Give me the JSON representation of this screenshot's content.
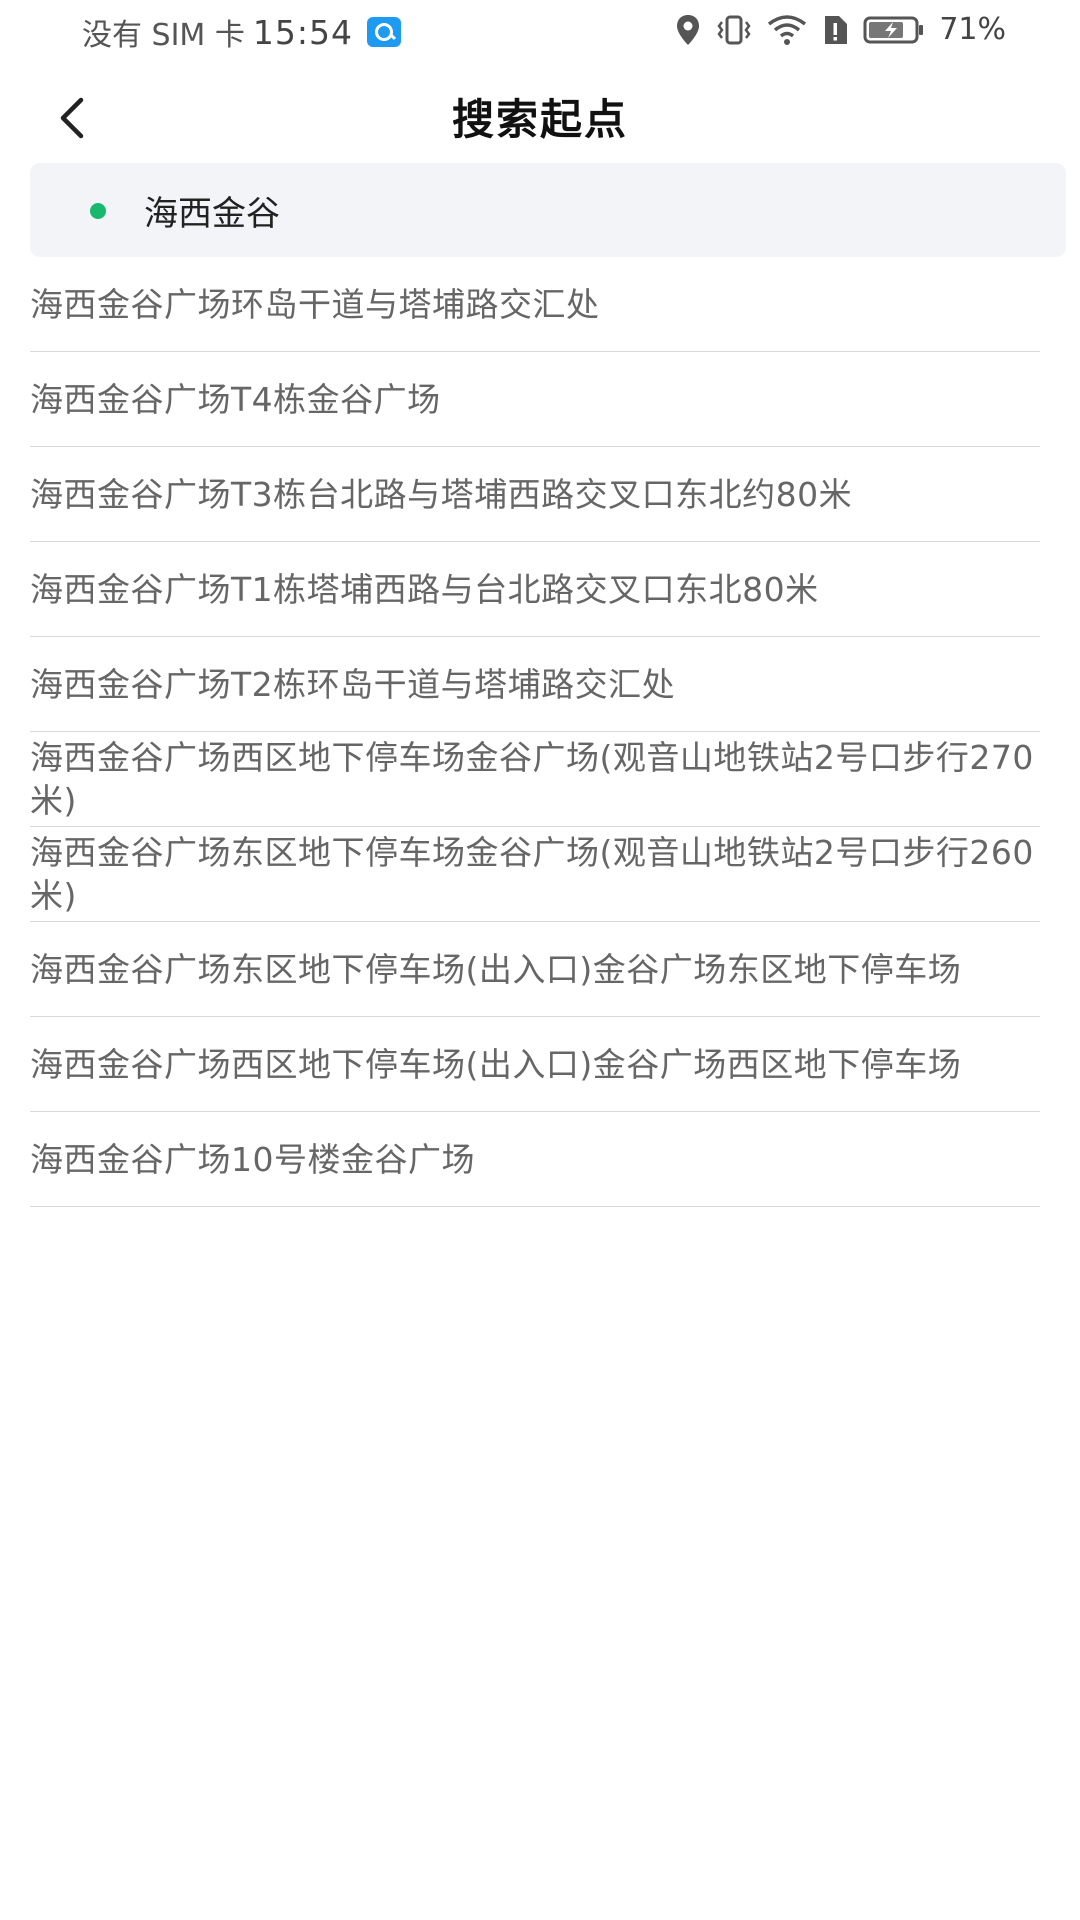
{
  "status_bar": {
    "carrier": "没有 SIM 卡",
    "time": "15:54",
    "battery": "71%",
    "icons": [
      "location-icon",
      "vibrate-icon",
      "wifi-icon",
      "sim-alert-icon",
      "battery-charging-icon"
    ]
  },
  "header": {
    "title": "搜索起点",
    "back_icon": "chevron-left-icon"
  },
  "search": {
    "value": "海西金谷"
  },
  "results": [
    "海西金谷广场环岛干道与塔埔路交汇处",
    "海西金谷广场T4栋金谷广场",
    "海西金谷广场T3栋台北路与塔埔西路交叉口东北约80米",
    "海西金谷广场T1栋塔埔西路与台北路交叉口东北80米",
    "海西金谷广场T2栋环岛干道与塔埔路交汇处",
    "海西金谷广场西区地下停车场金谷广场(观音山地铁站2号口步行270米)",
    "海西金谷广场东区地下停车场金谷广场(观音山地铁站2号口步行260米)",
    "海西金谷广场东区地下停车场(出入口)金谷广场东区地下停车场",
    "海西金谷广场西区地下停车场(出入口)金谷广场西区地下停车场",
    "海西金谷广场10号楼金谷广场"
  ],
  "colors": {
    "accent_dot": "#18b86e",
    "search_bg": "#f2f4f7",
    "result_text": "#666666"
  }
}
